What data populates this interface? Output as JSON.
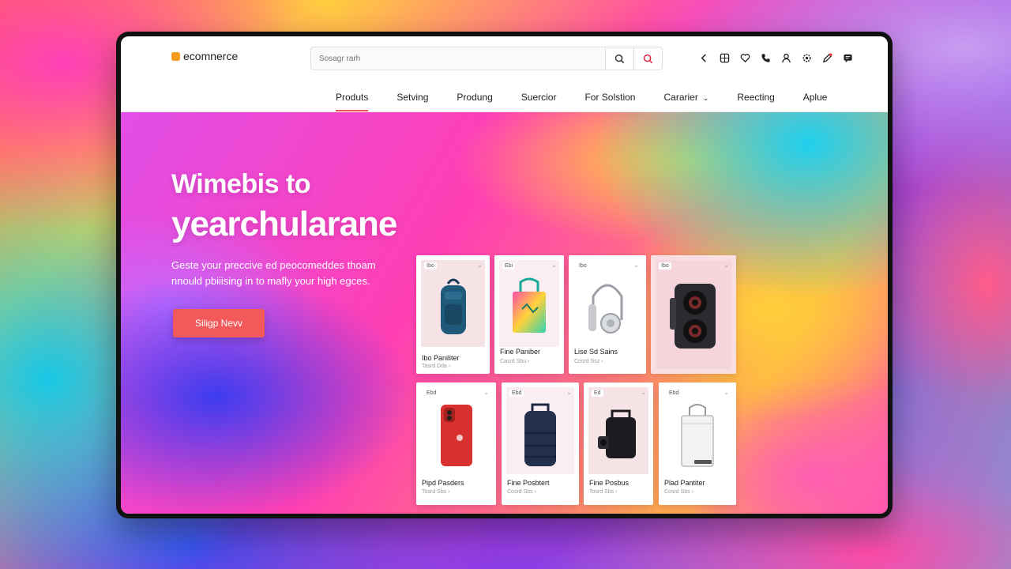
{
  "header": {
    "logo_text": "ecomnerce",
    "search_placeholder": "Sosagr rarh",
    "icons": [
      "back-icon",
      "grid-icon",
      "heart-icon",
      "phone-icon",
      "user-icon",
      "settings-icon",
      "edit-icon",
      "chat-icon"
    ]
  },
  "nav": [
    {
      "label": "Produts"
    },
    {
      "label": "Setving"
    },
    {
      "label": "Produng"
    },
    {
      "label": "Suercior"
    },
    {
      "label": "For Solstion"
    },
    {
      "label": "Cararier"
    },
    {
      "label": "Reecting"
    },
    {
      "label": "Aplue"
    }
  ],
  "hero": {
    "title_line1": "Wimebis to",
    "title_line2": "yearchularane",
    "subtitle": "Geste your preccive ed peocomeddes thoam nnould pbiiising in to mafly your high egces.",
    "cta_label": "Siligp Nevv"
  },
  "products": [
    {
      "badge": "Ibo",
      "name": "Ibo Paniliter",
      "meta": "Tasrd Dda ›"
    },
    {
      "badge": "Ebi",
      "name": "Fine Paniber",
      "meta": "Casrd Sbu ›"
    },
    {
      "badge": "Ibo",
      "name": "Lise Sd Sains",
      "meta": "Cosrd Ssz ›"
    },
    {
      "badge": "Ibo",
      "name": "",
      "meta": ""
    },
    {
      "badge": "Ebd",
      "name": "Pipd Pasders",
      "meta": "Tosrd Sbs ›"
    },
    {
      "badge": "Ebd",
      "name": "Fine Posbtert",
      "meta": "Cosrd Sbs ›"
    },
    {
      "badge": "Ed",
      "name": "Fine Posbus",
      "meta": "Tosrd Sbs ›"
    },
    {
      "badge": "Ebd",
      "name": "Plad Pantiter",
      "meta": "Cosrd Sbs ›"
    }
  ],
  "colors": {
    "accent": "#f2595b",
    "logo": "#f29b1e",
    "search_accent": "#d8263c"
  }
}
